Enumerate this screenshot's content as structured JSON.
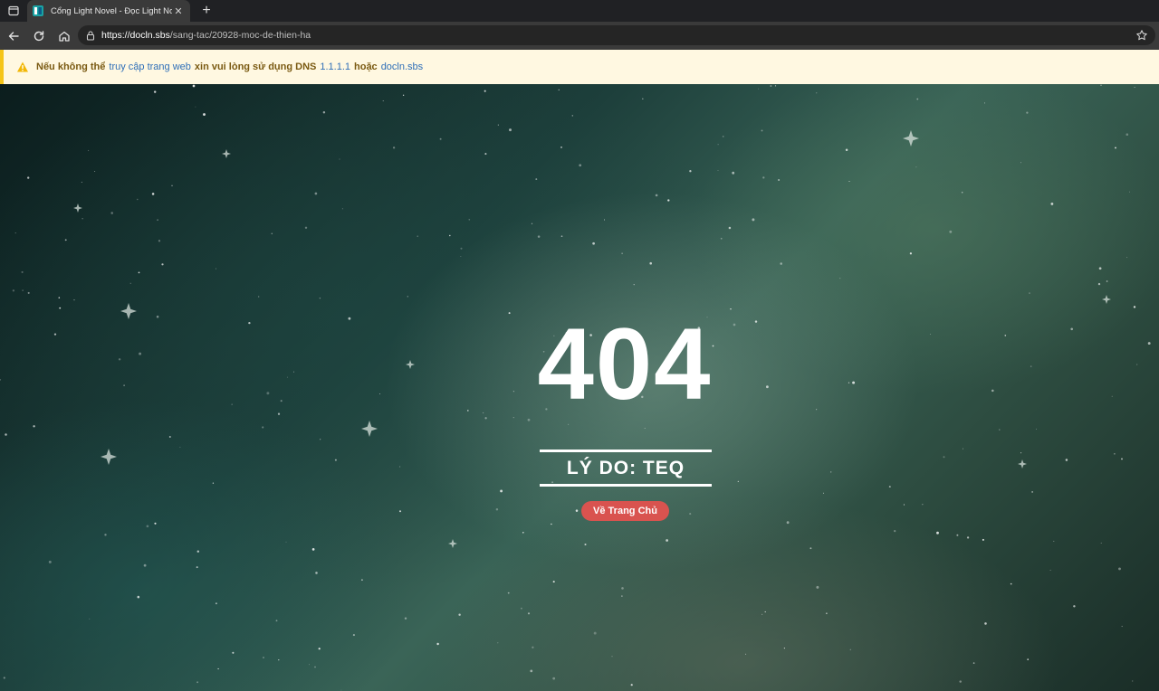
{
  "browser": {
    "tab": {
      "title": "Cổng Light Novel - Đọc Light Nov",
      "close_glyph": "✕"
    },
    "new_tab_glyph": "+",
    "url": {
      "host": "https://docln.sbs",
      "path": "/sang-tac/20928-moc-de-thien-ha"
    }
  },
  "notice": {
    "part1": "Nếu không thể",
    "link1": "truy cập trang web",
    "part2": "xin vui lòng sử dụng DNS",
    "link2": "1.1.1.1",
    "part3": "hoặc",
    "link3": "docln.sbs",
    "accent_color": "#f5c518"
  },
  "error": {
    "code": "404",
    "reason": "LÝ DO: TEQ",
    "home_button": "Về Trang Chủ",
    "button_color": "#d9534f"
  },
  "icons": [
    "tab-actions-icon",
    "favicon-icon",
    "close-icon",
    "plus-icon",
    "back-icon",
    "reload-icon",
    "home-icon",
    "lock-icon",
    "star-icon",
    "warning-icon"
  ]
}
